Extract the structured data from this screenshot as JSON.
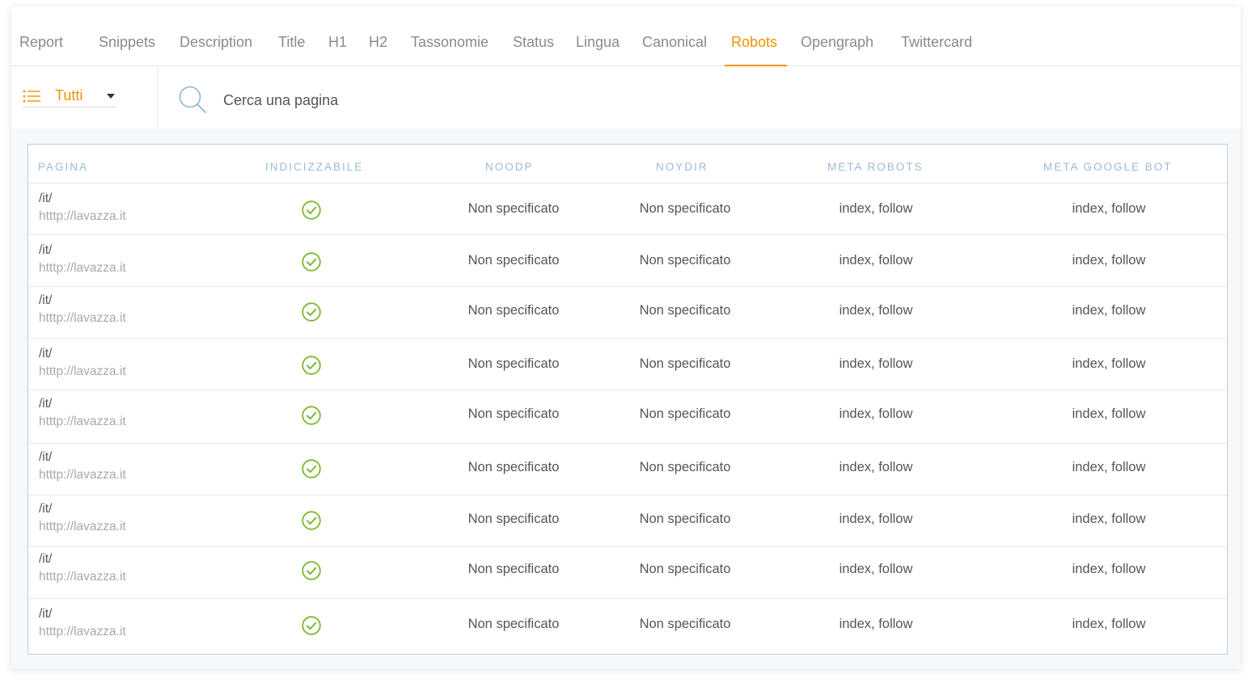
{
  "tabs": [
    {
      "label": "Report",
      "active": false
    },
    {
      "label": "Snippets",
      "active": false
    },
    {
      "label": "Description",
      "active": false
    },
    {
      "label": "Title",
      "active": false
    },
    {
      "label": "H1",
      "active": false
    },
    {
      "label": "H2",
      "active": false
    },
    {
      "label": "Tassonomie",
      "active": false
    },
    {
      "label": "Status",
      "active": false
    },
    {
      "label": "Lingua",
      "active": false
    },
    {
      "label": "Canonical",
      "active": false
    },
    {
      "label": "Robots",
      "active": true
    },
    {
      "label": "Opengraph",
      "active": false
    },
    {
      "label": "Twittercard",
      "active": false
    }
  ],
  "filter": {
    "selected": "Tutti",
    "icon": "list-icon"
  },
  "search": {
    "placeholder": "Cerca una pagina",
    "icon": "search-icon"
  },
  "table": {
    "headers": [
      "PAGINA",
      "INDICIZZABILE",
      "NOODP",
      "NOYDIR",
      "META ROBOTS",
      "META GOOGLE BOT"
    ],
    "rows": [
      {
        "path": "/it/",
        "url": "htttp://lavazza.it",
        "indexable": true,
        "noodp": "Non specificato",
        "noydir": "Non specificato",
        "meta_robots": "index, follow",
        "meta_googlebot": "index, follow"
      },
      {
        "path": "/it/",
        "url": "htttp://lavazza.it",
        "indexable": true,
        "noodp": "Non specificato",
        "noydir": "Non specificato",
        "meta_robots": "index, follow",
        "meta_googlebot": "index, follow"
      },
      {
        "path": "/it/",
        "url": "htttp://lavazza.it",
        "indexable": true,
        "noodp": "Non specificato",
        "noydir": "Non specificato",
        "meta_robots": "index, follow",
        "meta_googlebot": "index, follow"
      },
      {
        "path": "/it/",
        "url": "htttp://lavazza.it",
        "indexable": true,
        "noodp": "Non specificato",
        "noydir": "Non specificato",
        "meta_robots": "index, follow",
        "meta_googlebot": "index, follow"
      },
      {
        "path": "/it/",
        "url": "htttp://lavazza.it",
        "indexable": true,
        "noodp": "Non specificato",
        "noydir": "Non specificato",
        "meta_robots": "index, follow",
        "meta_googlebot": "index, follow"
      },
      {
        "path": "/it/",
        "url": "htttp://lavazza.it",
        "indexable": true,
        "noodp": "Non specificato",
        "noydir": "Non specificato",
        "meta_robots": "index, follow",
        "meta_googlebot": "index, follow"
      },
      {
        "path": "/it/",
        "url": "htttp://lavazza.it",
        "indexable": true,
        "noodp": "Non specificato",
        "noydir": "Non specificato",
        "meta_robots": "index, follow",
        "meta_googlebot": "index, follow"
      },
      {
        "path": "/it/",
        "url": "htttp://lavazza.it",
        "indexable": true,
        "noodp": "Non specificato",
        "noydir": "Non specificato",
        "meta_robots": "index, follow",
        "meta_googlebot": "index, follow"
      },
      {
        "path": "/it/",
        "url": "htttp://lavazza.it",
        "indexable": true,
        "noodp": "Non specificato",
        "noydir": "Non specificato",
        "meta_robots": "index, follow",
        "meta_googlebot": "index, follow"
      }
    ]
  },
  "colors": {
    "accent": "#f39200",
    "check": "#7cb82f",
    "header_text": "#9cbad6",
    "table_border": "#b9d0e3"
  }
}
